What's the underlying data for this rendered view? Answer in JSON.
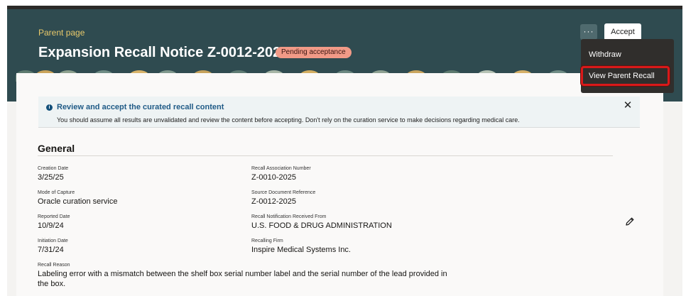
{
  "header": {
    "parent_label": "Parent page",
    "title": "Expansion Recall Notice Z-0012-2025",
    "status": "Pending acceptance",
    "more_label": "···",
    "accept_label": "Accept"
  },
  "menu": {
    "items": [
      {
        "label": "Withdraw"
      },
      {
        "label": "View Parent Recall"
      }
    ]
  },
  "banner": {
    "title": "Review and accept the curated recall content",
    "text": "You should assume all results are unvalidated and review the content before accepting. Don't rely on the curation service to make decisions regarding medical care."
  },
  "general": {
    "section_title": "General",
    "fields": {
      "creation_date": {
        "label": "Creation Date",
        "value": "3/25/25"
      },
      "recall_association_number": {
        "label": "Recall Association Number",
        "value": "Z-0010-2025"
      },
      "mode_of_capture": {
        "label": "Mode of Capture",
        "value": "Oracle curation service"
      },
      "source_document_reference": {
        "label": "Source Document Reference",
        "value": "Z-0012-2025"
      },
      "reported_date": {
        "label": "Reported Date",
        "value": "10/9/24"
      },
      "recall_notification_received_from": {
        "label": "Recall Notification Received From",
        "value": "U.S. FOOD & DRUG ADMINISTRATION"
      },
      "initiation_date": {
        "label": "Initiation Date",
        "value": "7/31/24"
      },
      "recalling_firm": {
        "label": "Recalling Firm",
        "value": "Inspire Medical Systems Inc."
      },
      "recall_reason": {
        "label": "Recall Reason",
        "value": "Labeling error with a mismatch between the shelf box serial number label and the serial number of the lead provided in the box."
      }
    }
  },
  "colors": {
    "header_bg": "#2f4b50",
    "accent_gold": "#e8c96b",
    "badge_bg": "#f19a87",
    "menu_bg": "#302e2c",
    "highlight": "#d9191a"
  }
}
